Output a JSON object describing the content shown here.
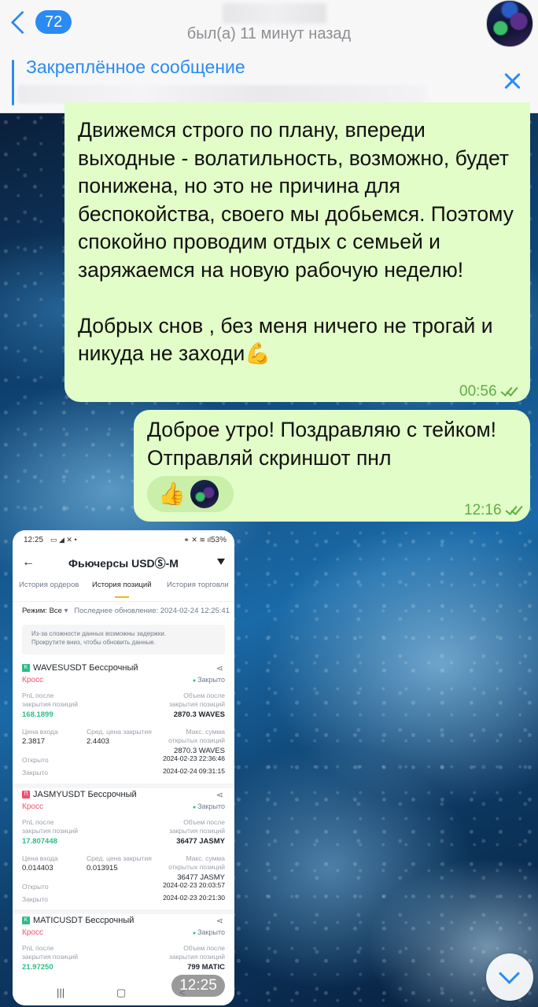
{
  "header": {
    "back_badge": "72",
    "status": "был(а) 11 минут назад"
  },
  "pinned": {
    "title": "Закреплённое сообщение"
  },
  "messages": [
    {
      "text": "Движемся строго по плану, впереди выходные - волатильность, возможно, будет понижена, но это не причина для беспокойства, своего мы добьемся. Поэтому спокойно проводим отдых с семьей и заряжаемся на новую рабочую неделю!\n\nДобрых снов , без меня ничего не трогай и никуда не заходи💪",
      "time": "00:56"
    },
    {
      "text": "Доброе утро! Поздравляю с тейком! Отправляй скриншот пнл",
      "reaction": "👍",
      "time": "12:16"
    }
  ],
  "screenshot": {
    "status_time": "12:25",
    "battery": "53%",
    "title": "Фьючерсы USDⓈ-M",
    "tabs": [
      "История ордеров",
      "История позиций",
      "История торговли"
    ],
    "mode_label": "Режим: Все",
    "last_update": "Последнее обновление: 2024-02-24 12:25:41",
    "notice_line1": "Из-за сложности данных возможны задержки.",
    "notice_line2": "Прокрутите вниз, чтобы обновить данные.",
    "positions": [
      {
        "badge": "K",
        "badge_color": "#2ebd85",
        "name": "WAVESUSDT Бессрочный",
        "margin": "Кросс",
        "status": "Закрыто",
        "pnl_label1": "PnL после",
        "pnl_label2": "закрытия позиций",
        "pnl": "168.1899",
        "vol_label1": "Объем после",
        "vol_label2": "закрытия позиций",
        "vol": "2870.3 WAVES",
        "entry_label": "Цена входа",
        "entry": "2.3817",
        "avg_close_label": "Сред. цена закрытия",
        "avg_close": "2.4403",
        "max_label1": "Макс. сумма",
        "max_label2": "открытых позиций",
        "max": "2870.3 WAVES",
        "opened_label": "Открыто",
        "opened": "2024-02-23 22:36:46",
        "closed_label": "Закрыто",
        "closed": "2024-02-24 09:31:15"
      },
      {
        "badge": "П",
        "badge_color": "#f0506e",
        "name": "JASMYUSDT Бессрочный",
        "margin": "Кросс",
        "status": "Закрыто",
        "pnl_label1": "PnL после",
        "pnl_label2": "закрытия позиций",
        "pnl": "17.807448",
        "vol_label1": "Объем после",
        "vol_label2": "закрытия позиций",
        "vol": "36477 JASMY",
        "entry_label": "Цена входа",
        "entry": "0.014403",
        "avg_close_label": "Сред. цена закрытия",
        "avg_close": "0.013915",
        "max_label1": "Макс. сумма",
        "max_label2": "открытых позиций",
        "max": "36477 JASMY",
        "opened_label": "Открыто",
        "opened": "2024-02-23 20:03:57",
        "closed_label": "Закрыто",
        "closed": "2024-02-23 20:21:30"
      },
      {
        "badge": "K",
        "badge_color": "#2ebd85",
        "name": "MATICUSDT Бессрочный",
        "margin": "Кросс",
        "status": "Закрыто",
        "pnl_label1": "PnL после",
        "pnl_label2": "закрытия позиций",
        "pnl": "21.97250",
        "vol_label1": "Объем после",
        "vol_label2": "закрытия позиций",
        "vol": "799 MATIC"
      }
    ],
    "nav": [
      "|||",
      "▢",
      "<"
    ],
    "time": "12:25"
  }
}
